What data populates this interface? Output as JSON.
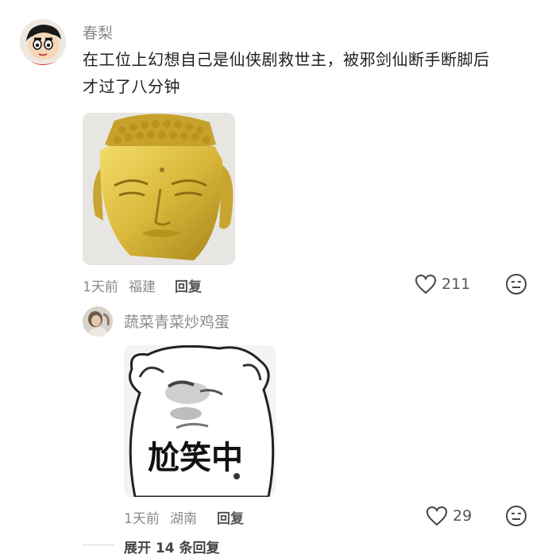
{
  "comment": {
    "author": "春梨",
    "text_line1": "在工位上幻想自己是仙侠剧救世主，被邪剑仙断手断脚后",
    "text_line2": "才过了八分钟",
    "time": "1天前",
    "location": "福建",
    "reply_label": "回复",
    "likes": "211"
  },
  "reply": {
    "author": "蔬菜青菜炒鸡蛋",
    "sticker_text": "尬笑中",
    "time": "1天前",
    "location": "湖南",
    "reply_label": "回复",
    "likes": "29"
  },
  "expand_label": "展开 14 条回复",
  "colors": {
    "gold": "#d9b73a",
    "muted": "#8a8a8a"
  }
}
